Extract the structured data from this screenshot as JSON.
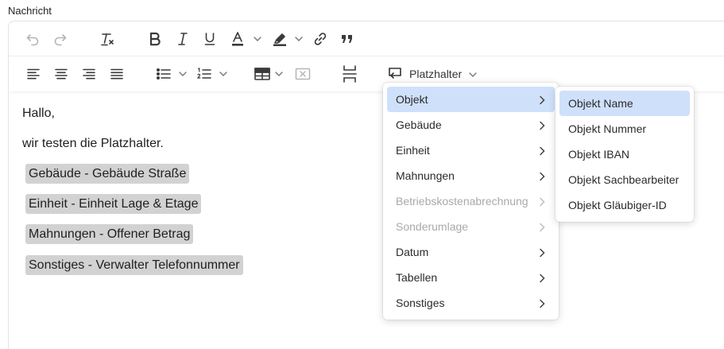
{
  "field_label": "Nachricht",
  "toolbar": {
    "row1": [
      "undo-icon",
      "redo-icon",
      "clear-format-icon",
      "bold-icon",
      "italic-icon",
      "underline-icon",
      "font-color-icon",
      "highlight-icon",
      "link-icon",
      "blockquote-icon"
    ],
    "row2": [
      "align-left-icon",
      "align-center-icon",
      "align-right-icon",
      "align-justify-icon",
      "bullet-list-icon",
      "numbered-list-icon",
      "table-icon",
      "remove-table-icon",
      "page-break-icon"
    ],
    "placeholder_label": "Platzhalter"
  },
  "content": {
    "greeting": "Hallo,",
    "line1": "wir testen die Platzhalter.",
    "chips": [
      "Gebäude - Gebäude Straße",
      "Einheit - Einheit Lage & Etage",
      "Mahnungen - Offener Betrag",
      "Sonstiges - Verwalter Telefonnummer"
    ]
  },
  "menu": {
    "items": [
      {
        "label": "Objekt",
        "active": true,
        "disabled": false
      },
      {
        "label": "Gebäude",
        "active": false,
        "disabled": false
      },
      {
        "label": "Einheit",
        "active": false,
        "disabled": false
      },
      {
        "label": "Mahnungen",
        "active": false,
        "disabled": false
      },
      {
        "label": "Betriebskostenabrechnung",
        "active": false,
        "disabled": true
      },
      {
        "label": "Sonderumlage",
        "active": false,
        "disabled": true
      },
      {
        "label": "Datum",
        "active": false,
        "disabled": false
      },
      {
        "label": "Tabellen",
        "active": false,
        "disabled": false
      },
      {
        "label": "Sonstiges",
        "active": false,
        "disabled": false
      }
    ],
    "submenu": [
      {
        "label": "Objekt Name",
        "active": true
      },
      {
        "label": "Objekt Nummer",
        "active": false
      },
      {
        "label": "Objekt IBAN",
        "active": false
      },
      {
        "label": "Objekt Sachbearbeiter",
        "active": false
      },
      {
        "label": "Objekt Gläubiger-ID",
        "active": false
      }
    ]
  },
  "colors": {
    "accent": "#cfe0fb",
    "chip": "#d2d2d2",
    "border": "#e3e3e3"
  }
}
